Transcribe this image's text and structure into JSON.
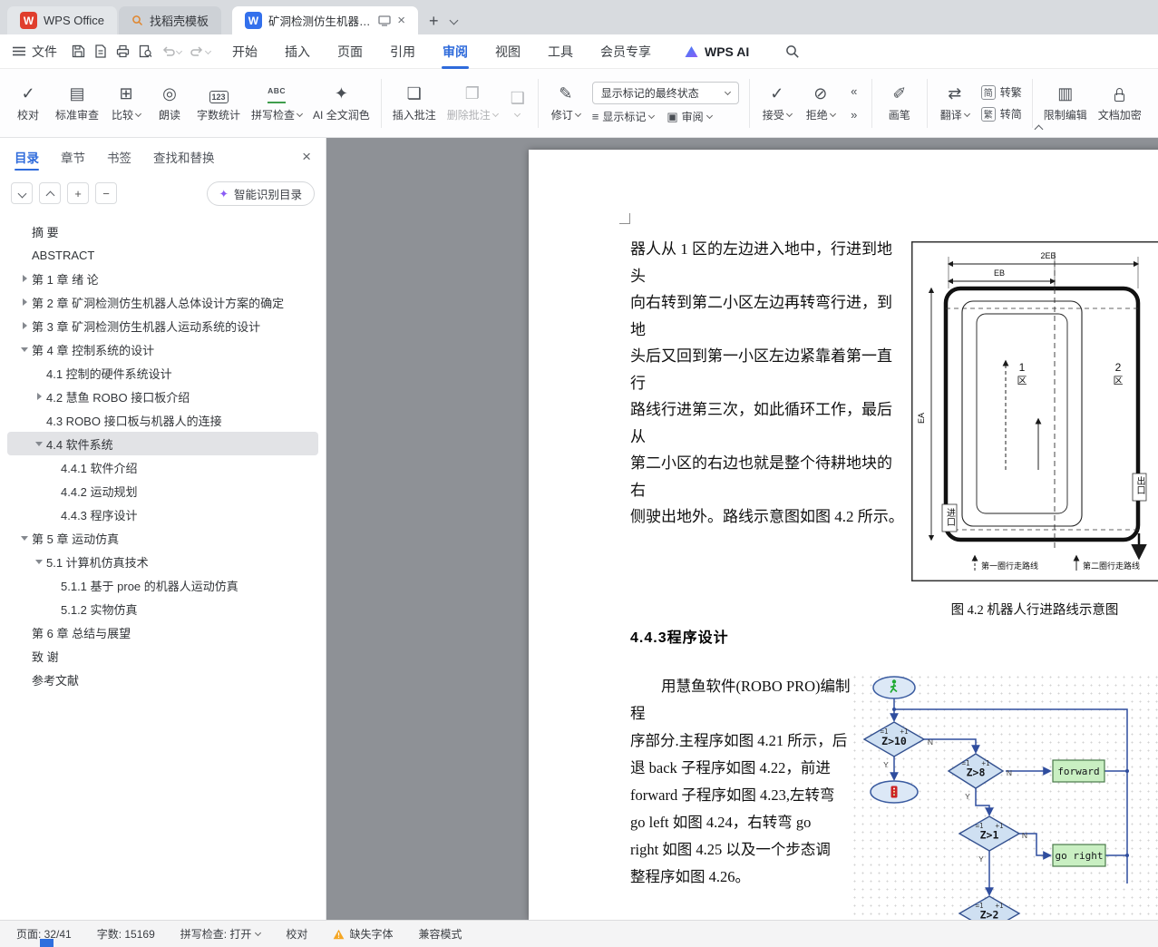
{
  "colors": {
    "accent": "#2f6bdb",
    "reject_red": "#d9413d",
    "warning": "#f5a623",
    "doc_bg": "#8e9196",
    "flow_line": "#2f4d9e",
    "flow_green": "#c9efc2",
    "flow_blue": "#cfe0f2"
  },
  "icons": {
    "proofread": "✓",
    "standard_review": "▤",
    "compare": "⊞",
    "read_aloud": "◎",
    "word_count": "123",
    "spell_check": "ABC",
    "ai_polish": "✦",
    "insert_comment": "❏",
    "delete_comment": "❐",
    "comment_more": "❑",
    "revise": "✎",
    "show_markup": "≡",
    "review_pane": "▣",
    "accept": "✓",
    "reject": "⊘",
    "prev_change": "«",
    "next_change": "»",
    "brush": "✐",
    "translate": "⇄",
    "restrict_edit": "▥",
    "smart_toc": "✦",
    "collapse_up": "⌃"
  },
  "tab_bar": {
    "app_tab": "WPS Office",
    "app_logo": "W",
    "template_tab": "找稻壳模板",
    "doc_title": "矿洞检测仿生机器人设计 毕业",
    "doc_logo": "W"
  },
  "menu": {
    "file": "文件",
    "tabs": [
      "开始",
      "插入",
      "页面",
      "引用",
      "审阅",
      "视图",
      "工具",
      "会员专享"
    ],
    "wps_ai": "WPS AI"
  },
  "ribbon": {
    "proofread": "校对",
    "standard_review": "标准审查",
    "compare": "比较",
    "read_aloud": "朗读",
    "word_count": "字数统计",
    "spell_check": "拼写检查",
    "ai_polish": "AI 全文润色",
    "insert_comment": "插入批注",
    "delete_comment": "删除批注",
    "revise": "修订",
    "markup_select": "显示标记的最终状态",
    "show_markup": "显示标记",
    "review_pane": "审阅",
    "accept": "接受",
    "reject": "拒绝",
    "brush": "画笔",
    "translate": "翻译",
    "simp": "简",
    "trad": "繁",
    "to_trad": "转繁",
    "to_simp": "转简",
    "restrict_edit": "限制编辑",
    "encrypt": "文档加密"
  },
  "sidebar": {
    "tabs": [
      "目录",
      "章节",
      "书签",
      "查找和替换"
    ],
    "smart_toc": "智能识别目录",
    "toc": [
      {
        "label": "摘  要",
        "level": 1,
        "arrow": "none"
      },
      {
        "label": "ABSTRACT",
        "level": 1,
        "arrow": "none"
      },
      {
        "label": "第 1 章 绪  论",
        "level": 1,
        "arrow": "right"
      },
      {
        "label": "第 2 章  矿洞检测仿生机器人总体设计方案的确定",
        "level": 1,
        "arrow": "right"
      },
      {
        "label": "第 3 章  矿洞检测仿生机器人运动系统的设计",
        "level": 1,
        "arrow": "right"
      },
      {
        "label": "第 4 章  控制系统的设计",
        "level": 1,
        "arrow": "down"
      },
      {
        "label": "4.1 控制的硬件系统设计",
        "level": 2,
        "arrow": "none"
      },
      {
        "label": "4.2 慧鱼  ROBO 接口板介绍",
        "level": 2,
        "arrow": "right"
      },
      {
        "label": "4.3 ROBO 接口板与机器人的连接",
        "level": 2,
        "arrow": "none"
      },
      {
        "label": "4.4 软件系统",
        "level": 2,
        "arrow": "down",
        "selected": true
      },
      {
        "label": "4.4.1 软件介绍",
        "level": 3,
        "arrow": "none"
      },
      {
        "label": "4.4.2 运动规划",
        "level": 3,
        "arrow": "none"
      },
      {
        "label": "4.4.3 程序设计",
        "level": 3,
        "arrow": "none"
      },
      {
        "label": "第 5 章 运动仿真",
        "level": 1,
        "arrow": "down"
      },
      {
        "label": "5.1 计算机仿真技术",
        "level": 2,
        "arrow": "down"
      },
      {
        "label": "5.1.1 基于 proe 的机器人运动仿真",
        "level": 3,
        "arrow": "none"
      },
      {
        "label": "5.1.2 实物仿真",
        "level": 3,
        "arrow": "none"
      },
      {
        "label": "第 6 章  总结与展望",
        "level": 1,
        "arrow": "none"
      },
      {
        "label": "致  谢",
        "level": 1,
        "arrow": "none"
      },
      {
        "label": "参考文献",
        "level": 1,
        "arrow": "none"
      }
    ]
  },
  "document": {
    "para1": [
      "器人从 1 区的左边进入地中，行进到地头",
      "向右转到第二小区左边再转弯行进，到地",
      "头后又回到第一小区左边紧靠着第一直行",
      "路线行进第三次，如此循环工作，最后从",
      "第二小区的右边也就是整个待耕地块的右",
      "侧驶出地外。路线示意图如图 4.2 所示。"
    ],
    "figure": {
      "caption": "图 4.2 机器人行进路线示意图",
      "dim_2eb": "2EB",
      "dim_eb": "EB",
      "dim_ea": "EA",
      "zone1": "1",
      "zone2": "2",
      "zone_cn": "区",
      "entrance": "进口",
      "exit": "出口",
      "legend1": "第一圈行走路线",
      "legend2": "第二圈行走路线"
    },
    "heading": "4.4.3程序设计",
    "para2": [
      "用慧鱼软件(ROBO PRO)编制程",
      "序部分.主程序如图 4.21 所示，后",
      "退 back 子程序如图 4.22，前进",
      "forward 子程序如图 4.23,左转弯",
      "go left 如图 4.24，右转弯 go",
      "right 如图 4.25 以及一个步态调",
      "整程序如图 4.26。"
    ],
    "flowchart": {
      "conds": [
        "Z>10",
        "Z>8",
        "Z>1",
        "Z>2"
      ],
      "boxes": [
        "forward",
        "go right"
      ],
      "eq": "=1",
      "plus": "+1",
      "yes": "Y",
      "no": "N"
    }
  },
  "status": {
    "page": "页面: 32/41",
    "words": "字数: 15169",
    "spell": "拼写检查: 打开",
    "proofread": "校对",
    "missing_font": "缺失字体",
    "compat": "兼容模式"
  }
}
